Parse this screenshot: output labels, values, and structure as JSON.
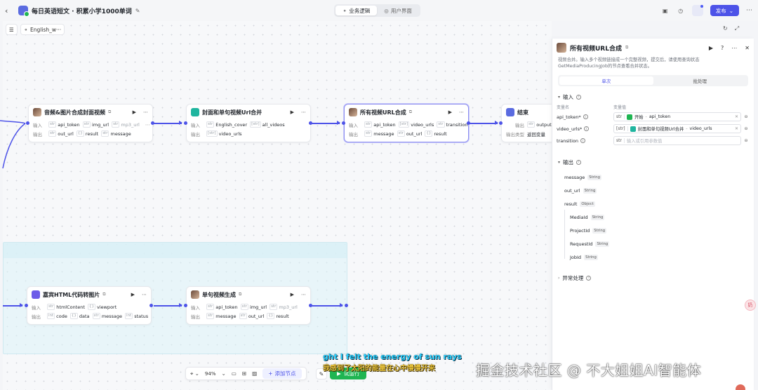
{
  "header": {
    "app_title": "每日英语短文 · 积累小学1000单词",
    "tabs": [
      {
        "label": "业务逻辑",
        "icon": "flow-icon"
      },
      {
        "label": "用户界面",
        "icon": "palette-icon"
      }
    ],
    "publish_label": "发布"
  },
  "canvas": {
    "workflow_tab_label": "English_w···",
    "zoom_level": "94%",
    "add_node_label": "添加节点",
    "run_label": "试运行"
  },
  "nodes": {
    "audio_image": {
      "title": "音频&图片合成封面视频",
      "input_label": "输入",
      "output_label": "输出",
      "inputs": [
        {
          "type": "str",
          "name": "api_token"
        },
        {
          "type": "str",
          "name": "img_url"
        },
        {
          "type": "str",
          "name": "mp3_url"
        }
      ],
      "outputs": [
        {
          "type": "str",
          "name": "out_url"
        },
        {
          "type": "{}",
          "name": "result"
        },
        {
          "type": "str",
          "name": "message"
        }
      ]
    },
    "merge_cover": {
      "title": "封面和单句视频Url合并",
      "input_label": "输入",
      "output_label": "输出",
      "inputs": [
        {
          "type": "str",
          "name": "English_cover"
        },
        {
          "type": "[str]",
          "name": "all_videos"
        }
      ],
      "outputs": [
        {
          "type": "[str]",
          "name": "video_urls"
        }
      ]
    },
    "all_video": {
      "title": "所有视频URL合成",
      "input_label": "输入",
      "output_label": "输出",
      "inputs": [
        {
          "type": "str",
          "name": "api_token"
        },
        {
          "type": "[str]",
          "name": "video_urls"
        },
        {
          "type": "str",
          "name": "transition"
        }
      ],
      "outputs": [
        {
          "type": "str",
          "name": "message"
        },
        {
          "type": "str",
          "name": "out_url"
        },
        {
          "type": "{}",
          "name": "result"
        }
      ]
    },
    "end": {
      "title": "结束",
      "output_label": "输出",
      "output_var": "output",
      "answer_type_label": "输出类型",
      "answer_type": "返回变量"
    },
    "html_to_image": {
      "title": "嘉宾HTML代码转图片",
      "input_label": "输入",
      "output_label": "输出",
      "inputs": [
        {
          "type": "str",
          "name": "htmlContent"
        },
        {
          "type": "{}",
          "name": "viewport"
        }
      ],
      "outputs": [
        {
          "type": "int",
          "name": "code"
        },
        {
          "type": "{}",
          "name": "data"
        },
        {
          "type": "str",
          "name": "message"
        },
        {
          "type": "int",
          "name": "status"
        }
      ]
    },
    "single_video": {
      "title": "单句视频生成",
      "input_label": "输入",
      "output_label": "输出",
      "inputs": [
        {
          "type": "str",
          "name": "api_token"
        },
        {
          "type": "str",
          "name": "img_url"
        },
        {
          "type": "str",
          "name": "mp3_url"
        }
      ],
      "outputs": [
        {
          "type": "str",
          "name": "message"
        },
        {
          "type": "str",
          "name": "out_url"
        },
        {
          "type": "{}",
          "name": "result"
        }
      ]
    }
  },
  "panel": {
    "title": "所有视频URL合成",
    "description": "视频合并。输入多个视频链接成一个完整视频，提交后，请使用查询状态GetMediaProducingJob的节点查看合并状态。",
    "tabs": [
      "单次",
      "批处理"
    ],
    "input_section": "输入",
    "col_var_name": "变量名",
    "col_var_value": "变量值",
    "inputs": [
      {
        "name": "api_token*",
        "type": "str",
        "ref_node": "开始",
        "ref_var": "api_token",
        "value": ""
      },
      {
        "name": "video_urls*",
        "type": "[str]",
        "ref_node": "封面和单句视频Url合并",
        "ref_var": "video_urls",
        "value": ""
      },
      {
        "name": "transition",
        "type": "str",
        "ref_node": "",
        "ref_var": "",
        "value": "输入或引用参数值"
      }
    ],
    "output_section": "输出",
    "outputs": [
      {
        "name": "message",
        "type": "String"
      },
      {
        "name": "out_url",
        "type": "String"
      },
      {
        "name": "result",
        "type": "Object"
      }
    ],
    "result_children": [
      {
        "name": "MediaId",
        "type": "String"
      },
      {
        "name": "ProjectId",
        "type": "String"
      },
      {
        "name": "RequestId",
        "type": "String"
      },
      {
        "name": "JobId",
        "type": "String"
      }
    ],
    "exception_section": "异常处理"
  },
  "overlay": {
    "subtitle_en": "ght I felt the energy of sun rays",
    "subtitle_zh": "我感到了太阳的能量在心中慢慢开来",
    "watermark": "掘金技术社区 @ 不大姐姐AI智能体",
    "float_icon_text": "奶"
  },
  "colors": {
    "accent": "#4d53e8",
    "run_green": "#1fb552",
    "subtitle_en": "#2ad0ff",
    "subtitle_zh": "#e8c23a"
  }
}
